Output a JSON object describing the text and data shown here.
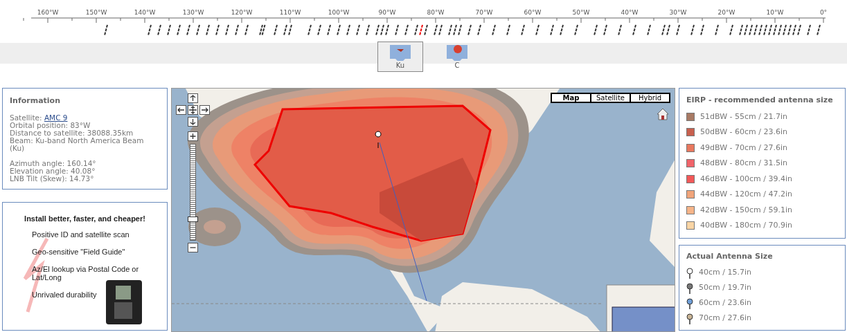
{
  "scale": {
    "labels": [
      "160°W",
      "150°W",
      "140°W",
      "130°W",
      "120°W",
      "110°W",
      "100°W",
      "90°W",
      "80°W",
      "70°W",
      "60°W",
      "50°W",
      "40°W",
      "30°W",
      "20°W",
      "10°W",
      "0°"
    ]
  },
  "bands": [
    {
      "label": "Ku",
      "selected": true
    },
    {
      "label": "C",
      "selected": false
    }
  ],
  "information": {
    "title": "Information",
    "satellite_label": "Satellite:",
    "satellite_link": "AMC 9",
    "details": [
      "Orbital position: 83°W",
      "Distance to satellite: 38088.35km",
      "Beam: Ku-band North America Beam (Ku)"
    ],
    "angles": [
      "Azimuth angle: 160.14°",
      "Elevation angle: 40.08°",
      "LNB Tilt (Skew): 14.73°"
    ]
  },
  "ad": {
    "headline": "Install better, faster, and cheaper!",
    "features": [
      "Positive ID and satellite scan",
      "Geo-sensitive \"Field Guide\"",
      "Az/El lookup via Postal Code or Lat/Long",
      "Unrivaled durability"
    ]
  },
  "map": {
    "map_types": [
      {
        "label": "Map",
        "selected": true
      },
      {
        "label": "Satellite",
        "selected": false
      },
      {
        "label": "Hybrid",
        "selected": false
      }
    ],
    "zoom_slider": {
      "level": 0.2
    }
  },
  "eirp_legend": {
    "title": "EIRP - recommended antenna size",
    "items": [
      {
        "label": "51dBW - 55cm / 21.7in",
        "color": "#a87a64"
      },
      {
        "label": "50dBW - 60cm / 23.6in",
        "color": "#c8604e"
      },
      {
        "label": "49dBW - 70cm / 27.6in",
        "color": "#e8785e"
      },
      {
        "label": "48dBW - 80cm / 31.5in",
        "color": "#f0646a"
      },
      {
        "label": "46dBW - 100cm / 39.4in",
        "color": "#f25858"
      },
      {
        "label": "44dBW - 120cm / 47.2in",
        "color": "#f0a47a"
      },
      {
        "label": "42dBW - 150cm / 59.1in",
        "color": "#f6b488"
      },
      {
        "label": "40dBW - 180cm / 70.9in",
        "color": "#f8d4a4"
      }
    ]
  },
  "antenna_sizes": {
    "title": "Actual Antenna Size",
    "items": [
      {
        "label": "40cm / 15.7in",
        "color": "#ffffff"
      },
      {
        "label": "50cm / 19.7in",
        "color": "#777777"
      },
      {
        "label": "60cm / 23.6in",
        "color": "#6f9fd8"
      },
      {
        "label": "70cm / 27.6in",
        "color": "#c8b496"
      }
    ]
  }
}
